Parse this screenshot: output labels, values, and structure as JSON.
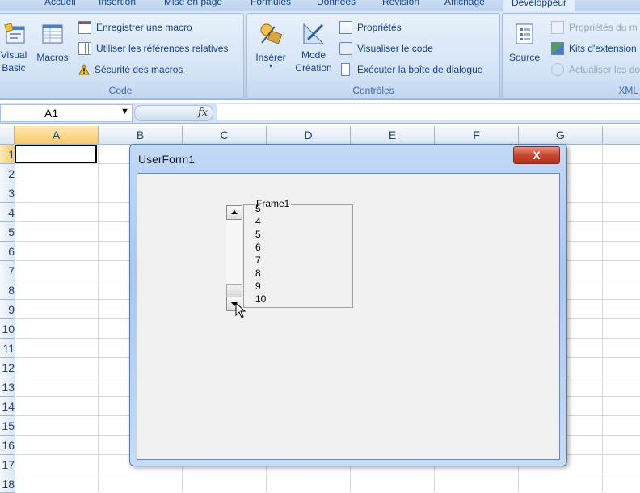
{
  "ribbon": {
    "tabs": [
      "Accueil",
      "Insertion",
      "Mise en page",
      "Formules",
      "Données",
      "Révision",
      "Affichage",
      "Développeur"
    ],
    "active_tab": "Développeur",
    "groups": {
      "code": {
        "label": "Code",
        "visual_basic": "Visual\nBasic",
        "macros": "Macros",
        "record_macro": "Enregistrer une macro",
        "relative_refs": "Utiliser les références relatives",
        "macro_security": "Sécurité des macros"
      },
      "controls": {
        "label": "Contrôles",
        "insert": "Insérer",
        "design_mode": "Mode\nCréation",
        "properties": "Propriétés",
        "view_code": "Visualiser le code",
        "run_dialog": "Exécuter la boîte de dialogue"
      },
      "xml": {
        "label": "XML",
        "source": "Source",
        "map_properties": "Propriétés du m",
        "expansion_packs": "Kits d'extension",
        "refresh_data": "Actualiser les do"
      }
    }
  },
  "formula_bar": {
    "name_box": "A1",
    "fx": "fx",
    "value": ""
  },
  "sheet": {
    "columns": [
      "A",
      "B",
      "C",
      "D",
      "E",
      "F",
      "G"
    ],
    "rows": [
      "1",
      "2",
      "3",
      "4",
      "5",
      "6",
      "7",
      "8",
      "9",
      "10",
      "11",
      "12",
      "13",
      "14",
      "15",
      "16",
      "17",
      "18"
    ],
    "active_cell": "A1"
  },
  "dialog": {
    "title": "UserForm1",
    "close_symbol": "X",
    "frame_caption": "Frame1",
    "list_items": [
      "5",
      "4",
      "5",
      "6",
      "7",
      "8",
      "9",
      "10"
    ]
  }
}
